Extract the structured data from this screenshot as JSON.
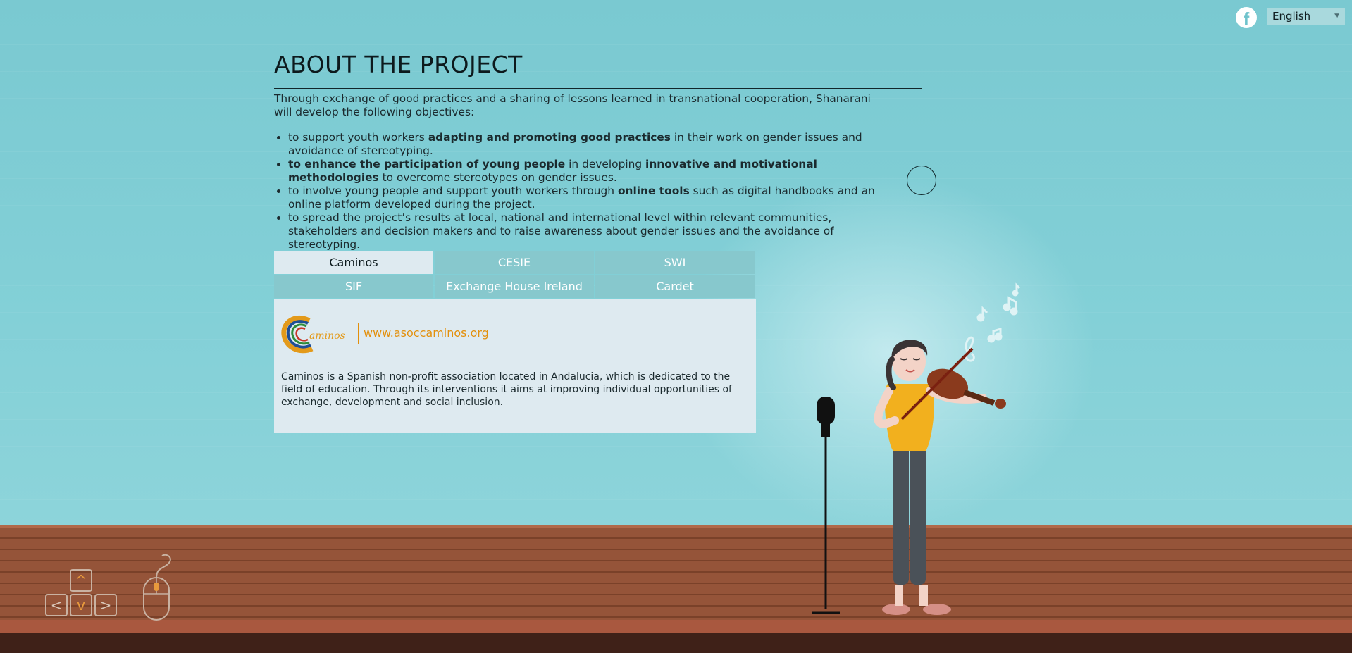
{
  "header": {
    "facebook_icon": "facebook-icon",
    "language": "English"
  },
  "about": {
    "title": "ABOUT THE PROJECT",
    "intro": "Through exchange of good practices and a sharing of lessons learned in transnational cooperation, Shanarani will develop the following objectives:",
    "objectives": [
      {
        "pre": "to support youth workers ",
        "b1": "adapting and promoting good practices",
        "mid": " in their work on gender issues and avoidance of stereotyping.",
        "b2": "",
        "post": ""
      },
      {
        "pre": "",
        "b1": "to enhance the participation of young people",
        "mid": " in developing ",
        "b2": "innovative and motivational methodologies",
        "post": " to overcome stereotypes on gender issues."
      },
      {
        "pre": "to involve young people and support youth workers through ",
        "b1": "online tools",
        "mid": " such as digital handbooks and an online platform developed during the project.",
        "b2": "",
        "post": ""
      },
      {
        "pre": "to spread the project’s results at local, national and international level within relevant communities, stakeholders and decision makers and to raise awareness about gender issues and the avoidance of stereotyping.",
        "b1": "",
        "mid": "",
        "b2": "",
        "post": ""
      }
    ]
  },
  "partners": {
    "tabs": [
      "Caminos",
      "CESIE",
      "SWI",
      "SIF",
      "Exchange House Ireland",
      "Cardet"
    ],
    "active": "Caminos",
    "logo_text": "aminos",
    "website": "www.asoccaminos.org",
    "description": "Caminos is a Spanish non-profit association located in Andalucia, which is dedicated to the field of education. Through its interventions it aims at improving individual opportunities of exchange, development and social inclusion."
  },
  "navigation": {
    "up": "^",
    "left": "<",
    "down": "v",
    "right": ">"
  },
  "colors": {
    "wall": "#7dccd4",
    "floor": "#955439",
    "accent": "#e3900c",
    "tab": "#87c8cd",
    "panel": "#deeaf0"
  }
}
